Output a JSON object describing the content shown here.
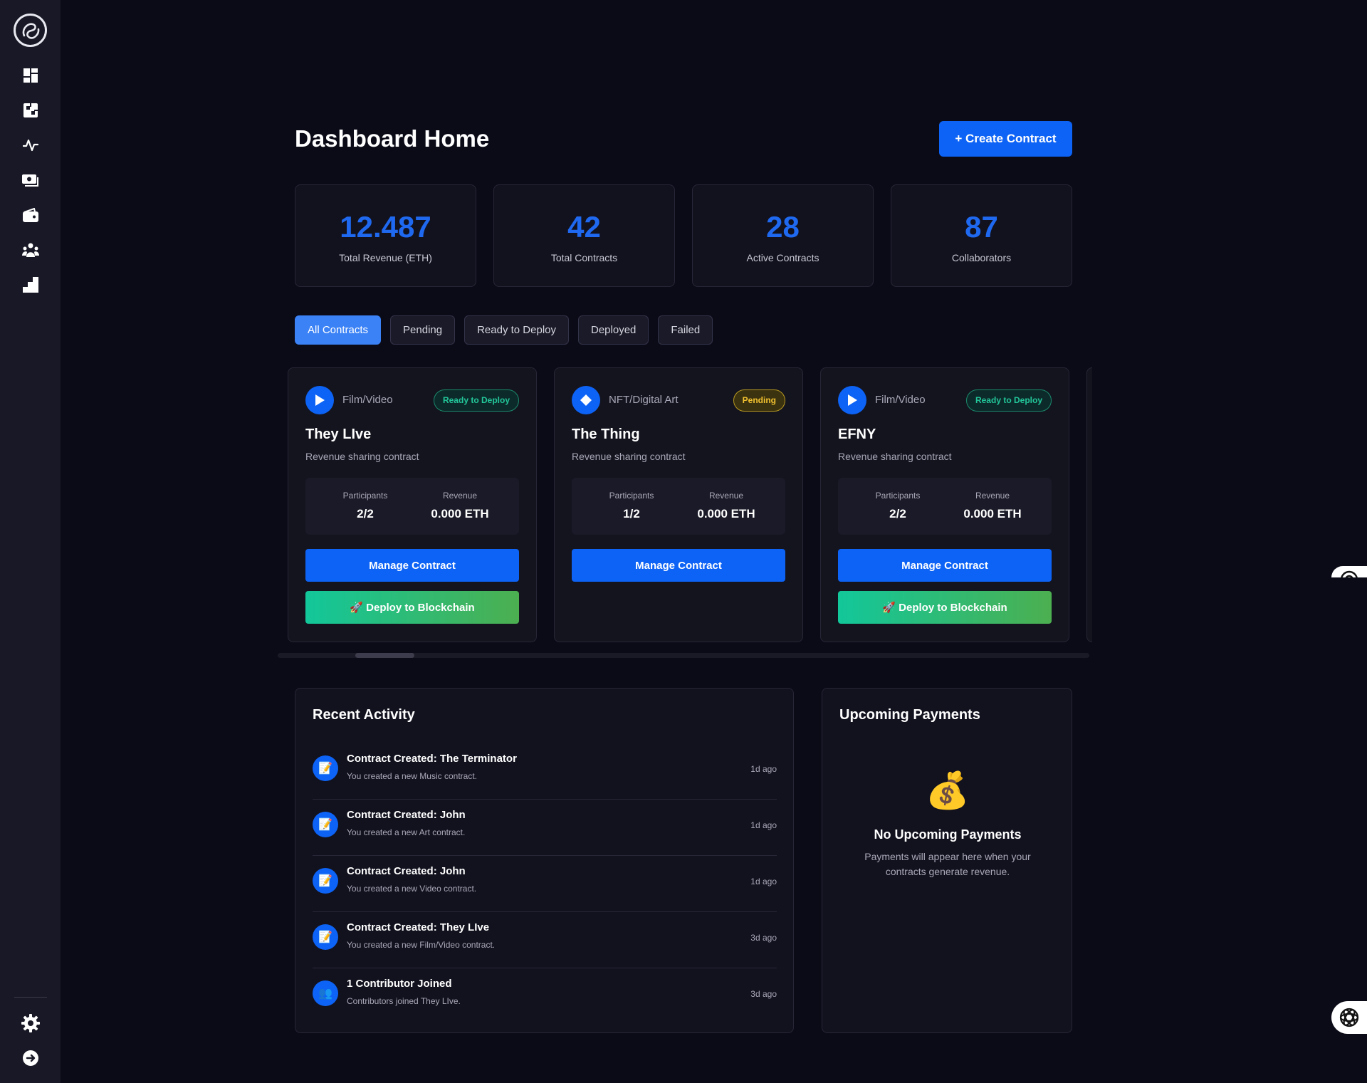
{
  "sidebar": {
    "logo_icon": "swirl-logo-icon",
    "nav": [
      {
        "icon": "dashboard-icon"
      },
      {
        "icon": "contracts-icon"
      },
      {
        "icon": "activity-icon"
      },
      {
        "icon": "payments-icon"
      },
      {
        "icon": "wallet-icon"
      },
      {
        "icon": "collaborators-icon"
      },
      {
        "icon": "analytics-icon"
      }
    ],
    "bottom": [
      {
        "icon": "gear-icon"
      },
      {
        "icon": "logout-icon"
      }
    ]
  },
  "header": {
    "title": "Dashboard Home",
    "create_label": "+ Create Contract"
  },
  "stats": [
    {
      "value": "12.487",
      "label": "Total Revenue (ETH)"
    },
    {
      "value": "42",
      "label": "Total Contracts"
    },
    {
      "value": "28",
      "label": "Active Contracts"
    },
    {
      "value": "87",
      "label": "Collaborators"
    }
  ],
  "filters": [
    {
      "label": "All Contracts",
      "active": true
    },
    {
      "label": "Pending",
      "active": false
    },
    {
      "label": "Ready to Deploy",
      "active": false
    },
    {
      "label": "Deployed",
      "active": false
    },
    {
      "label": "Failed",
      "active": false
    }
  ],
  "contracts": [
    {
      "icon": "play-icon",
      "type": "Film/Video",
      "status": "Ready to Deploy",
      "title": "They LIve",
      "subtitle": "Revenue sharing contract",
      "participants_label": "Participants",
      "participants": "2/2",
      "revenue_label": "Revenue",
      "revenue": "0.000 ETH",
      "manage_label": "Manage Contract",
      "deploy_label": "🚀 Deploy to Blockchain"
    },
    {
      "icon": "diamond-icon",
      "type": "NFT/Digital Art",
      "status": "Pending",
      "title": "The Thing",
      "subtitle": "Revenue sharing contract",
      "participants_label": "Participants",
      "participants": "1/2",
      "revenue_label": "Revenue",
      "revenue": "0.000 ETH",
      "manage_label": "Manage Contract"
    },
    {
      "icon": "play-icon",
      "type": "Film/Video",
      "status": "Ready to Deploy",
      "title": "EFNY",
      "subtitle": "Revenue sharing contract",
      "participants_label": "Participants",
      "participants": "2/2",
      "revenue_label": "Revenue",
      "revenue": "0.000 ETH",
      "manage_label": "Manage Contract",
      "deploy_label": "🚀 Deploy to Blockchain"
    }
  ],
  "activity": {
    "title": "Recent Activity",
    "items": [
      {
        "icon": "📝",
        "title": "Contract Created: The Terminator",
        "desc": "You created a new Music contract.",
        "time": "1d ago"
      },
      {
        "icon": "📝",
        "title": "Contract Created: John",
        "desc": "You created a new Art contract.",
        "time": "1d ago"
      },
      {
        "icon": "📝",
        "title": "Contract Created: John",
        "desc": "You created a new Video contract.",
        "time": "1d ago"
      },
      {
        "icon": "📝",
        "title": "Contract Created: They LIve",
        "desc": "You created a new Film/Video contract.",
        "time": "3d ago"
      },
      {
        "icon": "👥",
        "title": "1 Contributor Joined",
        "desc": "Contributors joined They LIve.",
        "time": "3d ago"
      }
    ]
  },
  "payments": {
    "title": "Upcoming Payments",
    "empty_icon": "💰",
    "empty_title": "No Upcoming Payments",
    "empty_desc": "Payments will appear here when your contracts generate revenue."
  },
  "colors": {
    "accent": "#0d63f5",
    "ready": "#22c79a",
    "pending": "#f2c230",
    "background": "#0b0b18"
  }
}
